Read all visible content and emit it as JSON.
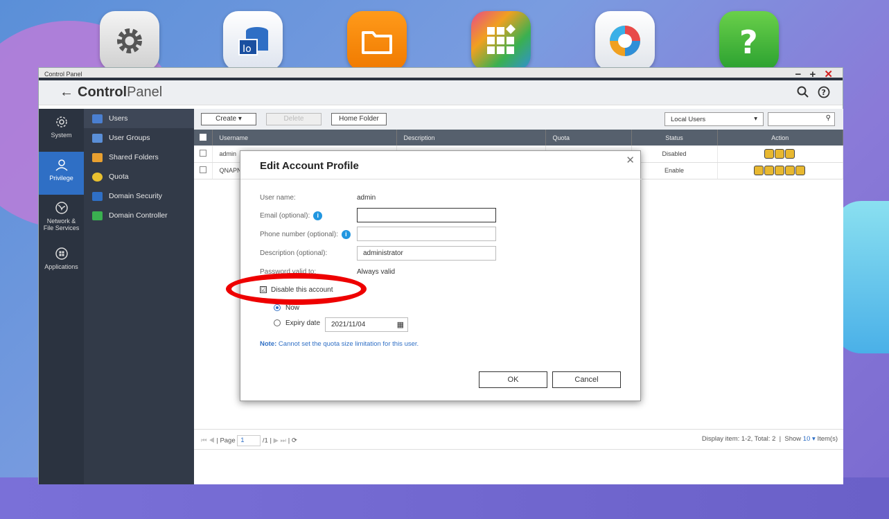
{
  "window": {
    "title": "Control Panel",
    "app_title_bold": "Control",
    "app_title_thin": "Panel",
    "controls": {
      "minimize": "−",
      "maximize": "+",
      "close": "✕"
    }
  },
  "dock": [
    "gear-icon",
    "storage-icon",
    "folder-icon",
    "app-center-icon",
    "helpdesk-icon",
    "help-icon"
  ],
  "rail": [
    {
      "label": "System",
      "icon": "gear-icon"
    },
    {
      "label": "Privilege",
      "icon": "user-icon"
    },
    {
      "label": "Network &\nFile Services",
      "icon": "globe-icon"
    },
    {
      "label": "Applications",
      "icon": "grid-icon"
    }
  ],
  "sub_nav": [
    {
      "label": "Users",
      "color": "#4a7fd0"
    },
    {
      "label": "User Groups",
      "color": "#5a8fd8"
    },
    {
      "label": "Shared Folders",
      "color": "#e8a030"
    },
    {
      "label": "Quota",
      "color": "#e8c030"
    },
    {
      "label": "Domain Security",
      "color": "#2f6fc5"
    },
    {
      "label": "Domain Controller",
      "color": "#3ab050"
    }
  ],
  "toolbar": {
    "create": "Create  ▾",
    "delete": "Delete",
    "home_folder": "Home Folder",
    "filter": "Local Users"
  },
  "table": {
    "headers": [
      "Username",
      "Description",
      "Quota",
      "Status",
      "Action"
    ],
    "rows": [
      {
        "username": "admin",
        "description": "",
        "quota": "",
        "status": "Disabled"
      },
      {
        "username": "QNAPN",
        "description": "",
        "quota": "",
        "status": "Enable"
      }
    ]
  },
  "pager": {
    "page_label": "Page",
    "page": "1",
    "total_pages": "/1",
    "display": "Display item: 1-2, Total: 2",
    "show_label": "Show",
    "show_value": "10",
    "items_label": "Item(s)"
  },
  "modal": {
    "title": "Edit Account Profile",
    "username_label": "User name:",
    "username_value": "admin",
    "email_label": "Email (optional):",
    "email_value": "",
    "phone_label": "Phone number (optional):",
    "phone_value": "",
    "description_label": "Description (optional):",
    "description_value": "administrator",
    "password_label": "Password valid to:",
    "password_value": "Always valid",
    "disable_label": "Disable this account",
    "disable_checked": "☑",
    "now_label": "Now",
    "expiry_label": "Expiry date",
    "expiry_value": "2021/11/04",
    "note_bold": "Note:",
    "note_text": " Cannot set the quota size limitation for this user.",
    "ok": "OK",
    "cancel": "Cancel"
  },
  "colors": {
    "accent": "#2f6fc5",
    "sidebar_dark": "#2b3340",
    "status_disabled": "#d02020",
    "highlight_ellipse": "#e00000"
  }
}
